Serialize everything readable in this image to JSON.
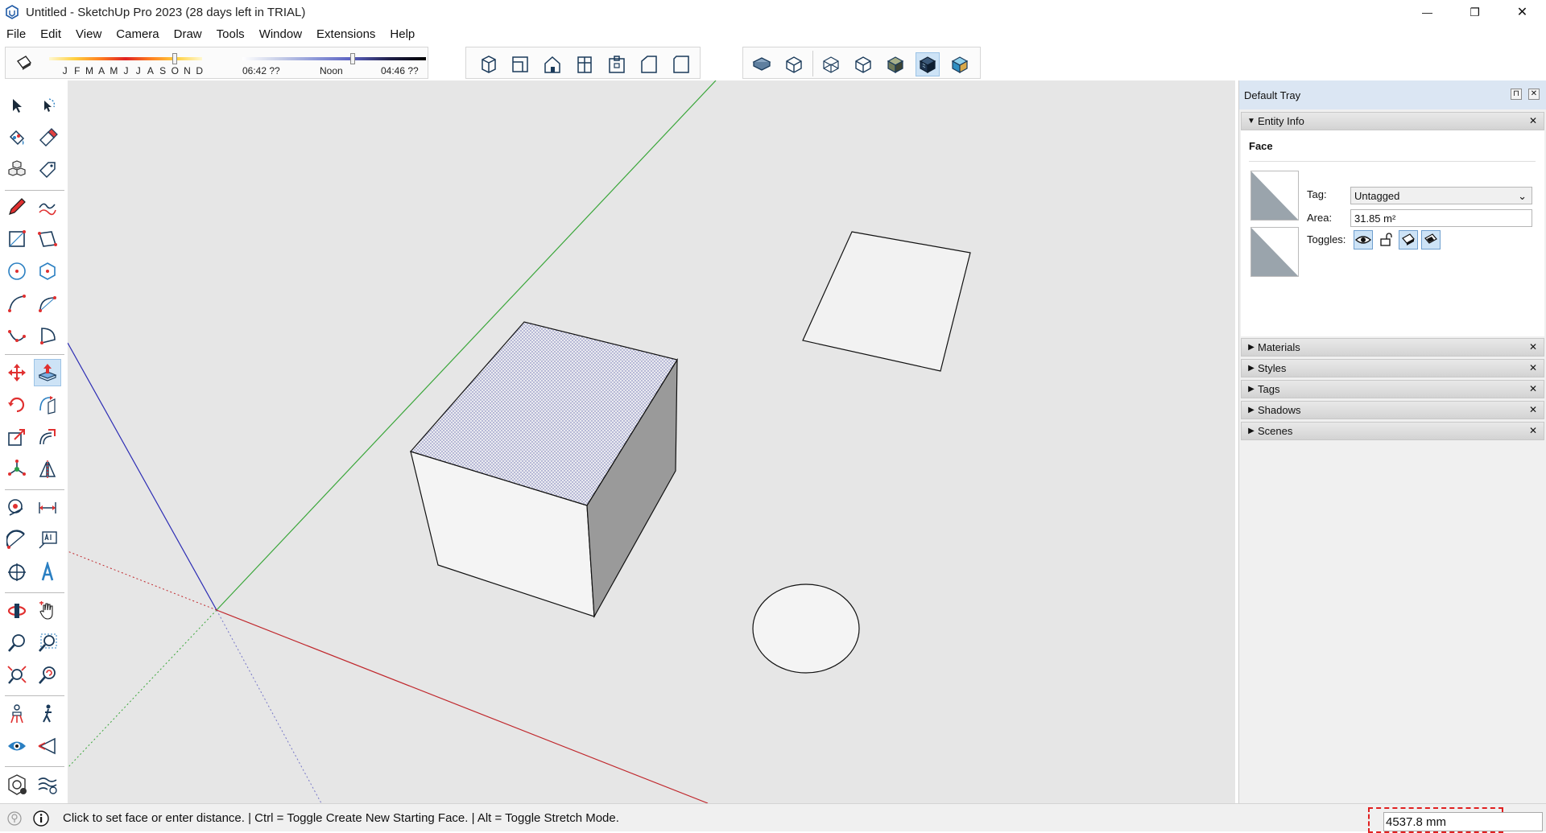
{
  "window": {
    "title": "Untitled - SketchUp Pro 2023 (28 days left in TRIAL)",
    "minimize": "—",
    "restore": "❐",
    "close": "✕"
  },
  "menu": [
    "File",
    "Edit",
    "View",
    "Camera",
    "Draw",
    "Tools",
    "Window",
    "Extensions",
    "Help"
  ],
  "shadows": {
    "months": [
      "J",
      "F",
      "M",
      "A",
      "M",
      "J",
      "J",
      "A",
      "S",
      "O",
      "N",
      "D"
    ],
    "sunrise": "06:42 ??",
    "noon": "Noon",
    "sunset": "04:46 ??",
    "date_slider_position": 0.82,
    "time_slider_position": 0.6
  },
  "toolbar": {
    "views": [
      "iso-view-icon",
      "top-view-icon",
      "front-view-icon",
      "right-view-icon",
      "back-view-icon",
      "left-view-icon",
      "bottom-view-icon"
    ],
    "styles": [
      "xray-icon",
      "back-edges-icon",
      "wireframe-icon",
      "hidden-line-icon",
      "shaded-icon",
      "shaded-with-textures-icon",
      "monochrome-icon"
    ],
    "active_style": "shaded-with-textures-icon"
  },
  "left_tools": {
    "active": "push-pull-icon"
  },
  "tray": {
    "title": "Default Tray",
    "pin": "⊓",
    "close": "✕",
    "entity_info": {
      "title": "Entity Info",
      "type": "Face",
      "tag_label": "Tag:",
      "tag_value": "Untagged",
      "area_label": "Area:",
      "area_value": "31.85 m²",
      "toggles_label": "Toggles:"
    },
    "panels": [
      "Materials",
      "Styles",
      "Tags",
      "Shadows",
      "Scenes"
    ]
  },
  "status": {
    "text": "Click to set face or enter distance. | Ctrl = Toggle Create New Starting Face. | Alt = Toggle Stretch Mode.",
    "measurement": "4537.8 mm"
  },
  "colors": {
    "viewport_bg": "#e6e6e6",
    "axis_red": "#c0282d",
    "axis_green": "#3aa63a",
    "axis_blue": "#2d2db4",
    "face_front": "#f4f4f4",
    "face_side": "#9a9a9a",
    "face_top_selected": "#cfd3e6",
    "accent": "#cde3f6"
  }
}
